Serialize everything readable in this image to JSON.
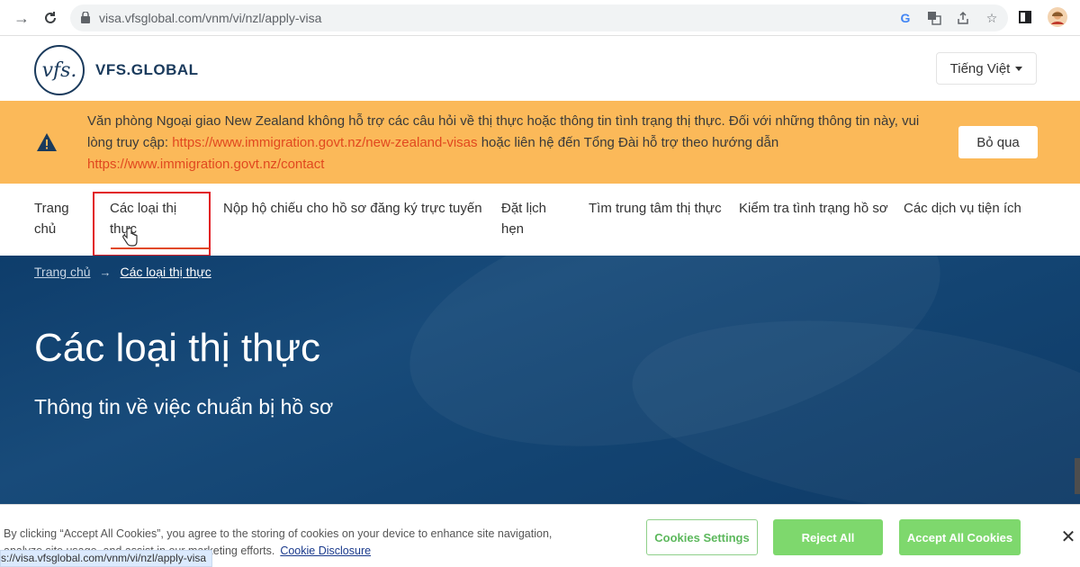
{
  "browser": {
    "url": "visa.vfsglobal.com/vnm/vi/nzl/apply-visa"
  },
  "header": {
    "logo_mark": "vfs.",
    "logo_text": "VFS.GLOBAL",
    "language": "Tiếng Việt"
  },
  "banner": {
    "text_part1": "Văn phòng Ngoại giao New Zealand không hỗ trợ các câu hỏi về thị thực hoặc thông tin tình trạng thị thực. Đối với những thông tin này, vui lòng truy cập: ",
    "link1": "https://www.immigration.govt.nz/new-zealand-visas",
    "text_part2": " hoặc liên hệ đến Tổng Đài hỗ trợ theo hướng dẫn ",
    "link2": "https://www.immigration.govt.nz/contact",
    "skip_label": "Bỏ qua"
  },
  "nav": {
    "items": [
      {
        "label": "Trang chủ"
      },
      {
        "label": "Các loại thị thực"
      },
      {
        "label": "Nộp hộ chiếu cho hồ sơ đăng ký trực tuyến"
      },
      {
        "label": "Đặt lịch hẹn"
      },
      {
        "label": "Tìm trung tâm thị thực"
      },
      {
        "label": "Kiểm tra tình trạng hồ sơ"
      },
      {
        "label": "Các dịch vụ tiện ích"
      }
    ]
  },
  "hero": {
    "breadcrumb_home": "Trang chủ",
    "breadcrumb_current": "Các loại thị thực",
    "title": "Các loại thị thực",
    "subtitle": "Thông tin về việc chuẩn bị hồ sơ"
  },
  "cookie": {
    "text": "By clicking “Accept All Cookies”, you agree to the storing of cookies on your device to enhance site navigation, analyze site usage, and assist in our marketing efforts.",
    "disclosure": "Cookie Disclosure",
    "settings_label": "Cookies Settings",
    "reject_label": "Reject All",
    "accept_label": "Accept All Cookies"
  },
  "status_bar": {
    "url": "s://visa.vfsglobal.com/vnm/vi/nzl/apply-visa"
  },
  "colors": {
    "banner_bg": "#fbb959",
    "hero_bg": "#134472",
    "accent_green": "#7ed86d",
    "link_orange": "#e1481f",
    "highlight_red": "#e21c24"
  }
}
